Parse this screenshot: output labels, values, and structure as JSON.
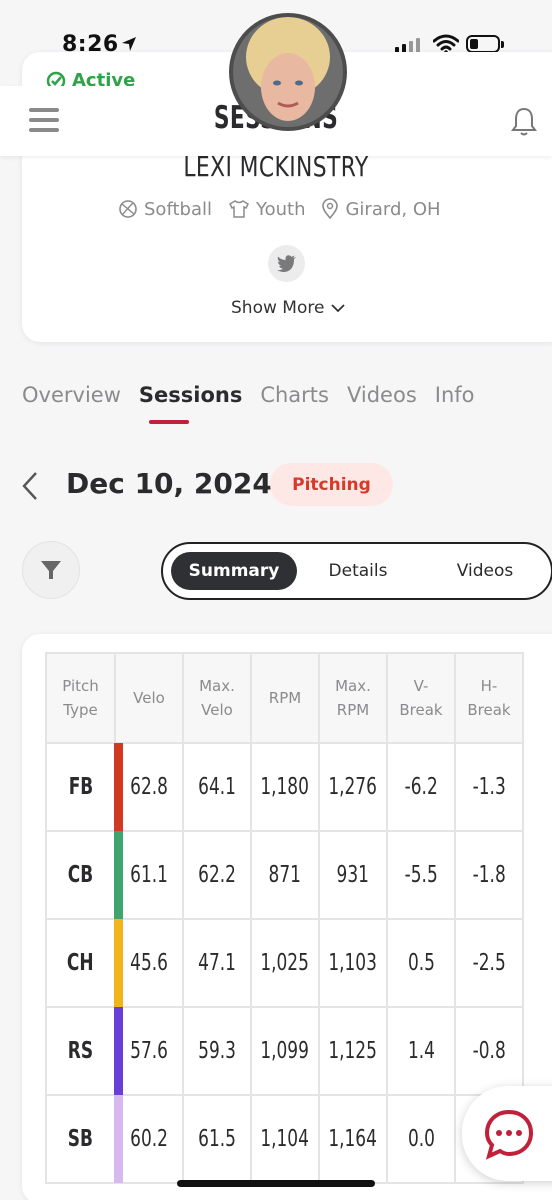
{
  "status_bar": {
    "time": "8:26"
  },
  "profile": {
    "status": "Active",
    "name": "LEXI MCKINSTRY",
    "sport": "Softball",
    "level": "Youth",
    "location": "Girard, OH",
    "show_more": "Show More"
  },
  "header": {
    "title": "SESSIONS"
  },
  "tabs": [
    {
      "label": "Overview",
      "active": false
    },
    {
      "label": "Sessions",
      "active": true
    },
    {
      "label": "Charts",
      "active": false
    },
    {
      "label": "Videos",
      "active": false
    },
    {
      "label": "Info",
      "active": false
    }
  ],
  "session": {
    "date": "Dec 10, 2024",
    "type": "Pitching"
  },
  "view_toggle": {
    "summary": "Summary",
    "details": "Details",
    "videos": "Videos",
    "selected": "Summary"
  },
  "table": {
    "headers": [
      [
        "Pitch",
        "Type"
      ],
      [
        "Velo"
      ],
      [
        "Max.",
        "Velo"
      ],
      [
        "RPM"
      ],
      [
        "Max.",
        "RPM"
      ],
      [
        "V-",
        "Break"
      ],
      [
        "H-",
        "Break"
      ]
    ],
    "rows": [
      {
        "type": "FB",
        "color": "#d13a22",
        "velo": "62.8",
        "max_velo": "64.1",
        "rpm": "1,180",
        "max_rpm": "1,276",
        "v_break": "-6.2",
        "h_break": "-1.3"
      },
      {
        "type": "CB",
        "color": "#3fa46f",
        "velo": "61.1",
        "max_velo": "62.2",
        "rpm": "871",
        "max_rpm": "931",
        "v_break": "-5.5",
        "h_break": "-1.8"
      },
      {
        "type": "CH",
        "color": "#f3b41b",
        "velo": "45.6",
        "max_velo": "47.1",
        "rpm": "1,025",
        "max_rpm": "1,103",
        "v_break": "0.5",
        "h_break": "-2.5"
      },
      {
        "type": "RS",
        "color": "#6a3fd6",
        "velo": "57.6",
        "max_velo": "59.3",
        "rpm": "1,099",
        "max_rpm": "1,125",
        "v_break": "1.4",
        "h_break": "-0.8"
      },
      {
        "type": "SB",
        "color": "#d8b8f0",
        "velo": "60.2",
        "max_velo": "61.5",
        "rpm": "1,104",
        "max_rpm": "1,164",
        "v_break": "0.0",
        "h_break": ""
      }
    ]
  },
  "colors": {
    "accent": "#c0203a",
    "active_green": "#2fa24a",
    "pill_bg": "#fde8e6",
    "pill_text": "#d73a2b"
  }
}
